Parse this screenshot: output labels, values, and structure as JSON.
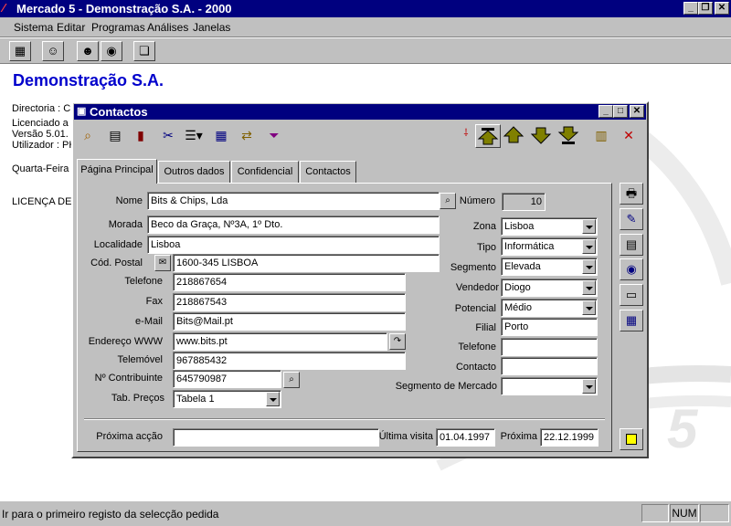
{
  "app": {
    "title": "Mercado 5 - Demonstração S.A. - 2000",
    "menu": [
      "Sistema",
      "Editar",
      "Programas",
      "Análises",
      "Janelas"
    ]
  },
  "background": {
    "company": "Demonstração S.A.",
    "lines": [
      "Directoria : C:",
      "Licenciado a",
      "Versão 5.01.",
      "Utilizador : PH",
      "Quarta-Feira",
      "LICENÇA DE I"
    ]
  },
  "dialog": {
    "title": "Contactos",
    "tabs": [
      "Página Principal",
      "Outros dados",
      "Confidencial",
      "Contactos"
    ],
    "labels": {
      "nome": "Nome",
      "morada": "Morada",
      "localidade": "Localidade",
      "cod_postal": "Cód. Postal",
      "telefone": "Telefone",
      "fax": "Fax",
      "email": "e-Mail",
      "www": "Endereço WWW",
      "telemovel": "Telemóvel",
      "contribuinte": "Nº Contribuinte",
      "tab_precos": "Tab. Preços",
      "numero": "Número",
      "zona": "Zona",
      "tipo": "Tipo",
      "segmento": "Segmento",
      "vendedor": "Vendedor",
      "potencial": "Potencial",
      "filial": "Filial",
      "telefone2": "Telefone",
      "contacto": "Contacto",
      "seg_mercado": "Segmento de Mercado",
      "proxima_accao": "Próxima acção",
      "ultima_visita": "Última visita",
      "proxima": "Próxima"
    },
    "values": {
      "nome": "Bits & Chips, Lda",
      "morada": "Beco da Graça, Nº3A, 1º Dto.",
      "localidade": "Lisboa",
      "cod_postal": "1600-345 LISBOA",
      "telefone": "218867654",
      "fax": "218867543",
      "email": "Bits@Mail.pt",
      "www": "www.bits.pt",
      "telemovel": "967885432",
      "contribuinte": "645790987",
      "tab_precos": "Tabela 1",
      "numero": "10",
      "zona": "Lisboa",
      "tipo": "Informática",
      "segmento": "Elevada",
      "vendedor": "Diogo",
      "potencial": "Médio",
      "filial": "Porto",
      "telefone2": "",
      "contacto": "",
      "seg_mercado": "",
      "proxima_accao": "",
      "ultima_visita": "01.04.1997",
      "proxima": "22.12.1999"
    }
  },
  "status": {
    "message": "Ir para o primeiro registo da selecção pedida",
    "num": "NUM"
  },
  "colors": {
    "titlebar": "#00007f",
    "face": "#c0c0c0",
    "heading": "#0000cc"
  }
}
